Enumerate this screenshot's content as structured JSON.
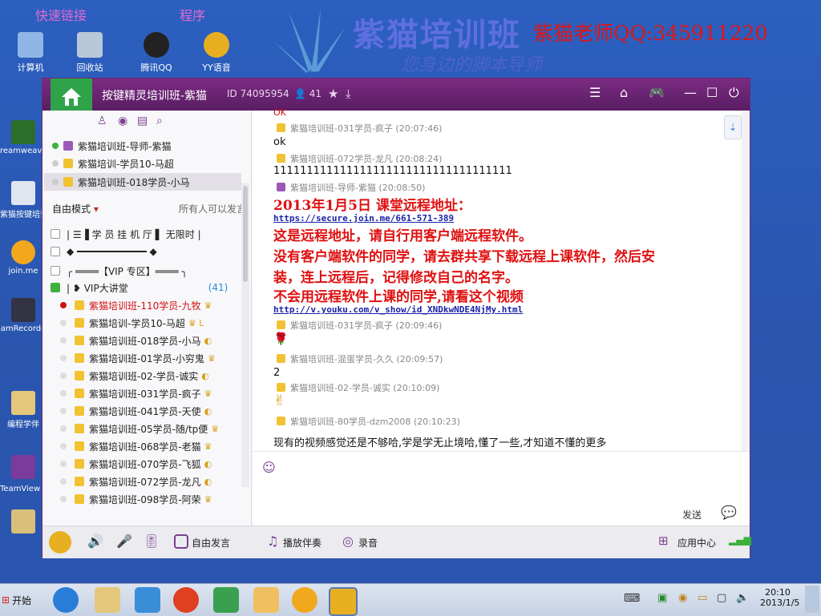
{
  "desktop": {
    "headings": [
      "快速链接",
      "程序"
    ],
    "icons_top": [
      "计算机",
      "回收站",
      "腾讯QQ",
      "YY语音"
    ],
    "icons_left": [
      "reamweave",
      "紫猫按键培训班介...",
      "join.me",
      "amRecorde",
      "编程学伴",
      "TeamView 破解版(",
      ""
    ],
    "brand": {
      "main": "紫猫培训班",
      "sub": "您身边的脚本导师"
    },
    "teacher_qq": "紫猫老师QQ:345911220"
  },
  "window": {
    "title": "按键精灵培训班-紫猫",
    "id": "ID 74095954",
    "member_count": "41",
    "admins": [
      {
        "name": "紫猫培训班-导师-紫猫",
        "online": true,
        "role": "purple"
      },
      {
        "name": "紫猫培训-学员10-马超",
        "online": false,
        "role": "gold"
      },
      {
        "name": "紫猫培训班-018学员-小马",
        "online": false,
        "role": "gold"
      }
    ],
    "mode": "自由模式",
    "mode_note": "所有人可以发言",
    "channels": [
      "| ☰▐ 学 员 挂 机 厅 ▌ 无限时 |",
      "◆ ━━━━━━━━━━━━ ◆",
      "╭ ════【VIP 专区】════ ╮"
    ],
    "vip_channel": {
      "name": "| ❥ VIP大讲堂",
      "count": "(41)"
    },
    "members": [
      {
        "name": "紫猫培训班-110学员-九牧",
        "badge": "♛",
        "red": true
      },
      {
        "name": "紫猫培训-学员10-马超",
        "badge": "♛ L",
        "red": false
      },
      {
        "name": "紫猫培训班-018学员-小马",
        "badge": "◐",
        "red": false
      },
      {
        "name": "紫猫培训班-01学员-小穷鬼",
        "badge": "♛",
        "red": false
      },
      {
        "name": "紫猫培训班-02-学员-诚实",
        "badge": "◐",
        "red": false
      },
      {
        "name": "紫猫培训班-031学员-疯子",
        "badge": "♛",
        "red": false
      },
      {
        "name": "紫猫培训班-041学员-天使",
        "badge": "◐",
        "red": false
      },
      {
        "name": "紫猫培训班-05学员-随/tp便",
        "badge": "♛",
        "red": false
      },
      {
        "name": "紫猫培训班-068学员-老猫",
        "badge": "♛",
        "red": false
      },
      {
        "name": "紫猫培训班-070学员-飞狐",
        "badge": "◐",
        "red": false
      },
      {
        "name": "紫猫培训班-072学员-龙凡",
        "badge": "◐",
        "red": false
      },
      {
        "name": "紫猫培训班-098学员-阿荣",
        "badge": "♛",
        "red": false
      }
    ],
    "chat": {
      "top_cut": "OK",
      "m1_meta": "紫猫培训班-031学员-疯子 (20:07:46)",
      "m1_body": "ok",
      "m2_meta": "紫猫培训班-072学员-龙凡 (20:08:24)",
      "m2_body": "111111111111111111111111111111111111",
      "m3_meta": "紫猫培训班-导师-紫猫 (20:08:50)",
      "m3_line1": "2013年1月5日 课堂远程地址：",
      "m3_link1": "https://secure.join.me/661-571-389",
      "m3_line2": "这是远程地址，请自行用客户端远程软件。",
      "m3_line3": "没有客户端软件的同学，请去群共享下载远程上课软件，然后安",
      "m3_line4": "装，连上远程后，记得修改自己的名字。",
      "m3_line5": "不会用远程软件上课的同学,请看这个视频",
      "m3_link2": "http://v.youku.com/v_show/id_XNDkwNDE4NjMy.html",
      "m4_meta": "紫猫培训班-031学员-疯子 (20:09:46)",
      "m4_body": "🌹",
      "m5_meta": "紫猫培训班-混蛋学员-久久 (20:09:57)",
      "m5_body": "2",
      "m6_meta": "紫猫培训班-02-学员-诚实 (20:10:09)",
      "m6_body": "✌",
      "m7_meta": "紫猫培训班-80学员-dzm2008 (20:10:23)",
      "m7_body": "现有的视频感觉还是不够哈,学是学无止境哈,懂了一些,才知道不懂的更多"
    },
    "send_label": "发送",
    "bottom": {
      "free_speech": "自由发言",
      "play_music": "播放伴奏",
      "record": "录音",
      "app_center": "应用中心"
    }
  },
  "taskbar": {
    "start": "开始",
    "time": "20:10",
    "date": "2013/1/5"
  }
}
